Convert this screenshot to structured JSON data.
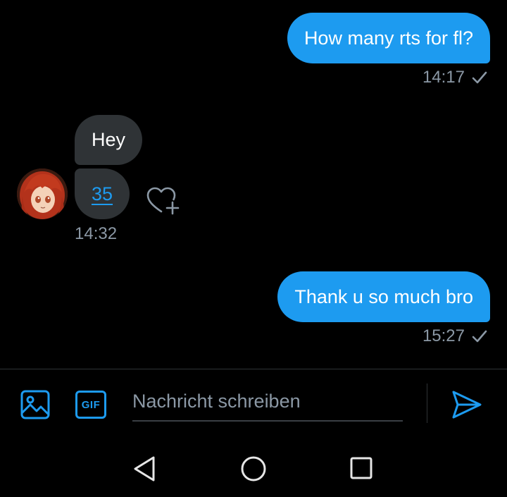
{
  "conversation": {
    "messages": [
      {
        "direction": "out",
        "text": "How many rts for fl?",
        "time": "14:17"
      },
      {
        "direction": "in",
        "text": "Hey"
      },
      {
        "direction": "in",
        "text": "35",
        "time": "14:32"
      },
      {
        "direction": "out",
        "text": "Thank u so much bro",
        "time": "15:27"
      }
    ]
  },
  "composer": {
    "placeholder": "Nachricht schreiben",
    "gif_label": "GIF"
  },
  "icons": {
    "media": "image-icon",
    "gif": "gif-icon",
    "send": "send-icon",
    "react": "heart-add-icon",
    "read_receipt": "check-icon",
    "nav": [
      "back-icon",
      "home-icon",
      "recents-icon"
    ]
  },
  "colors": {
    "accent": "#1d9bf0",
    "incoming_bubble": "#2f3336",
    "muted_text": "#8b98a5",
    "background": "#000000"
  }
}
